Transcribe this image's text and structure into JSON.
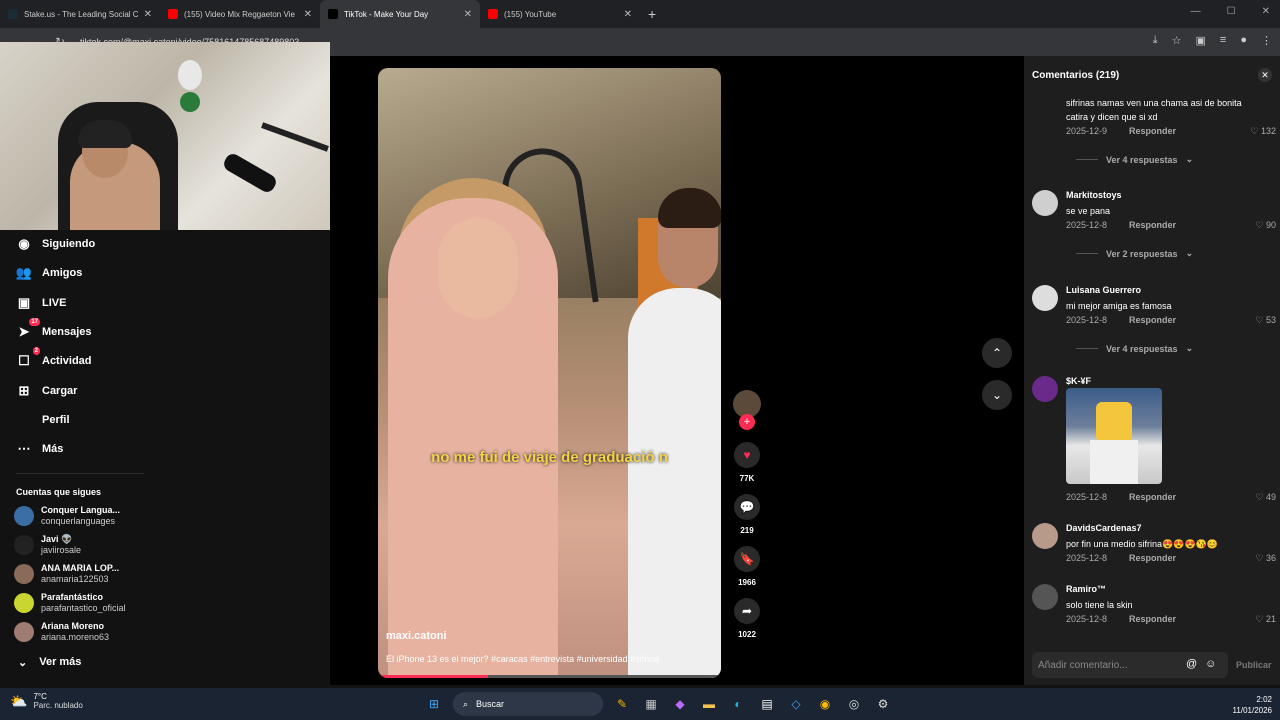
{
  "browser": {
    "tabs": [
      {
        "label": "Stake.us - The Leading Social C",
        "color": "#1a2c38",
        "active": false
      },
      {
        "label": "(155) Video Mix Reggaeton Vie",
        "color": "#ff0000",
        "active": false
      },
      {
        "label": "TikTok - Make Your Day",
        "color": "#000000",
        "active": true
      },
      {
        "label": "(155) YouTube",
        "color": "#ff0000",
        "active": false
      }
    ],
    "url": "tiktok.com/@maxi.catoni/video/7581614785687489803",
    "new_tab": "+",
    "close_glyph": "✕"
  },
  "sidebar": {
    "menu": [
      {
        "label": "Siguiendo",
        "icon": "following-icon",
        "glyph": "◉",
        "badge": ""
      },
      {
        "label": "Amigos",
        "icon": "friends-icon",
        "glyph": "👥",
        "badge": ""
      },
      {
        "label": "LIVE",
        "icon": "live-icon",
        "glyph": "▣",
        "badge": ""
      },
      {
        "label": "Mensajes",
        "icon": "messages-icon",
        "glyph": "➤",
        "badge": "17"
      },
      {
        "label": "Actividad",
        "icon": "activity-icon",
        "glyph": "☐",
        "badge": "2"
      },
      {
        "label": "Cargar",
        "icon": "upload-icon",
        "glyph": "⊞",
        "badge": ""
      },
      {
        "label": "Perfil",
        "icon": "profile-icon",
        "glyph": "",
        "badge": ""
      },
      {
        "label": "Más",
        "icon": "more-icon",
        "glyph": "⋯",
        "badge": ""
      }
    ],
    "following_title": "Cuentas que sigues",
    "accounts": [
      {
        "name": "Conquer Langua...",
        "handle": "conquerlanguages",
        "color": "#3a6ea5"
      },
      {
        "name": "Javi 👽",
        "handle": "javiirosale",
        "color": "#222222"
      },
      {
        "name": "ANA MARIA LOP...",
        "handle": "anamaria122503",
        "color": "#8a6b5a"
      },
      {
        "name": "Parafantástico",
        "handle": "parafantastico_oficial",
        "color": "#c9d530"
      },
      {
        "name": "Ariana Moreno",
        "handle": "ariana.moreno63",
        "color": "#a07c70"
      }
    ],
    "see_more": "Ver más"
  },
  "video": {
    "caption": "no me fui de viaje de graduació n",
    "author": "maxi.catoni",
    "description": "El iPhone 13 es el mejor? #caracas #entrevista #universidad #sifrina",
    "progress": 0.32
  },
  "actions": [
    {
      "name": "like",
      "glyph": "♥",
      "count": "77K",
      "color": "#fe2c55"
    },
    {
      "name": "comment",
      "glyph": "💬",
      "count": "219",
      "color": "#ffffff"
    },
    {
      "name": "bookmark",
      "glyph": "🔖",
      "count": "1966",
      "color": "#ffffff"
    },
    {
      "name": "share",
      "glyph": "➦",
      "count": "1022",
      "color": "#ffffff"
    }
  ],
  "comments": {
    "title": "Comentarios",
    "count": "(219)",
    "items": [
      {
        "user": "",
        "text": "sifrinas namas ven una chama asi de bonita catira y dicen que si xd",
        "date": "2025-12-9",
        "reply": "Responder",
        "likes": "132",
        "replies": "Ver 4 respuestas",
        "avatar": ""
      },
      {
        "user": "Markitostoys",
        "text": "se ve pana",
        "date": "2025-12-8",
        "reply": "Responder",
        "likes": "90",
        "replies": "Ver 2 respuestas",
        "avatar": "#cfcfcf"
      },
      {
        "user": "Luisana Guerrero",
        "text": "mi mejor amiga es famosa",
        "date": "2025-12-8",
        "reply": "Responder",
        "likes": "53",
        "replies": "Ver 4 respuestas",
        "avatar": "#dddddd"
      },
      {
        "user": "$K-¥F",
        "text": "",
        "date": "2025-12-8",
        "reply": "Responder",
        "likes": "49",
        "replies": "",
        "avatar": "#6a2a8a"
      },
      {
        "user": "DavidsCardenas7",
        "text": "por fin una medio sifrina😍😍😍😘😊",
        "date": "2025-12-8",
        "reply": "Responder",
        "likes": "36",
        "replies": "",
        "avatar": "#b89a8a"
      },
      {
        "user": "Ramiro™",
        "text": "solo tiene la skin",
        "date": "2025-12-8",
        "reply": "Responder",
        "likes": "21",
        "replies": "",
        "avatar": "#555555"
      }
    ],
    "input_placeholder": "Añadir comentario...",
    "publish": "Publicar"
  },
  "taskbar": {
    "temp": "7°C",
    "weather": "Parc. nublado",
    "search": "Buscar",
    "time": "2:02",
    "date": "11/01/2026"
  }
}
